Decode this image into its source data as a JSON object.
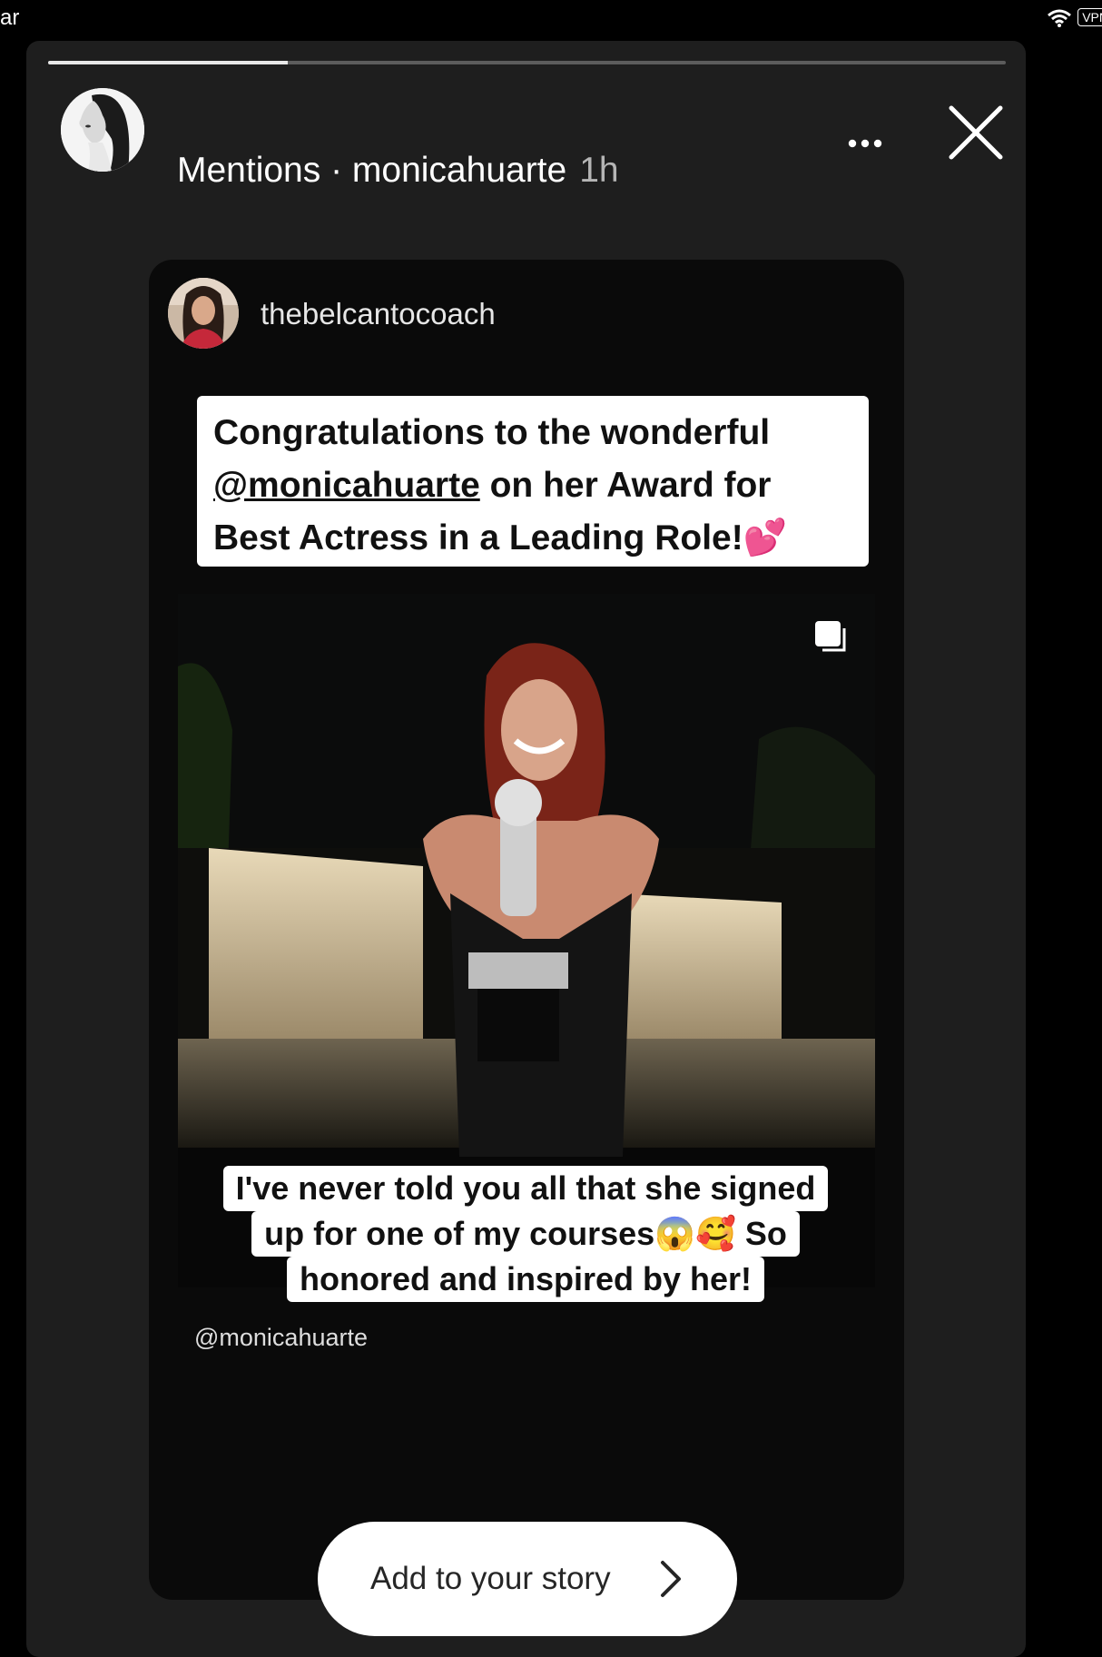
{
  "status_bar": {
    "left_text": "ar",
    "vpn_label": "VPN"
  },
  "story": {
    "progress": 0.25,
    "header": {
      "title": "Mentions · monicahuarte",
      "time": "1h"
    },
    "post": {
      "username": "thebelcantocoach",
      "caption_top": {
        "line1": "Congratulations to the wonderful",
        "mention": "@monicahuarte",
        "line2_rest": " on her Award for",
        "line3": "Best Actress in a Leading Role!",
        "emoji": "💕"
      },
      "caption_bottom": {
        "line1": "I've never told you all that she signed",
        "line2": "up for one of my courses",
        "line2_emoji": "😱🥰",
        "line2_rest": " So",
        "line3": "honored and inspired by her!"
      },
      "mention_tag": "@monicahuarte"
    },
    "add_story_label": "Add to your story"
  },
  "colors": {
    "background": "#000000",
    "story_frame": "#1e1e1e",
    "accent_pink": "#e8418f"
  },
  "icons": [
    "wifi-icon",
    "more-icon",
    "close-icon",
    "multi-photo-icon",
    "chevron-right-icon"
  ]
}
